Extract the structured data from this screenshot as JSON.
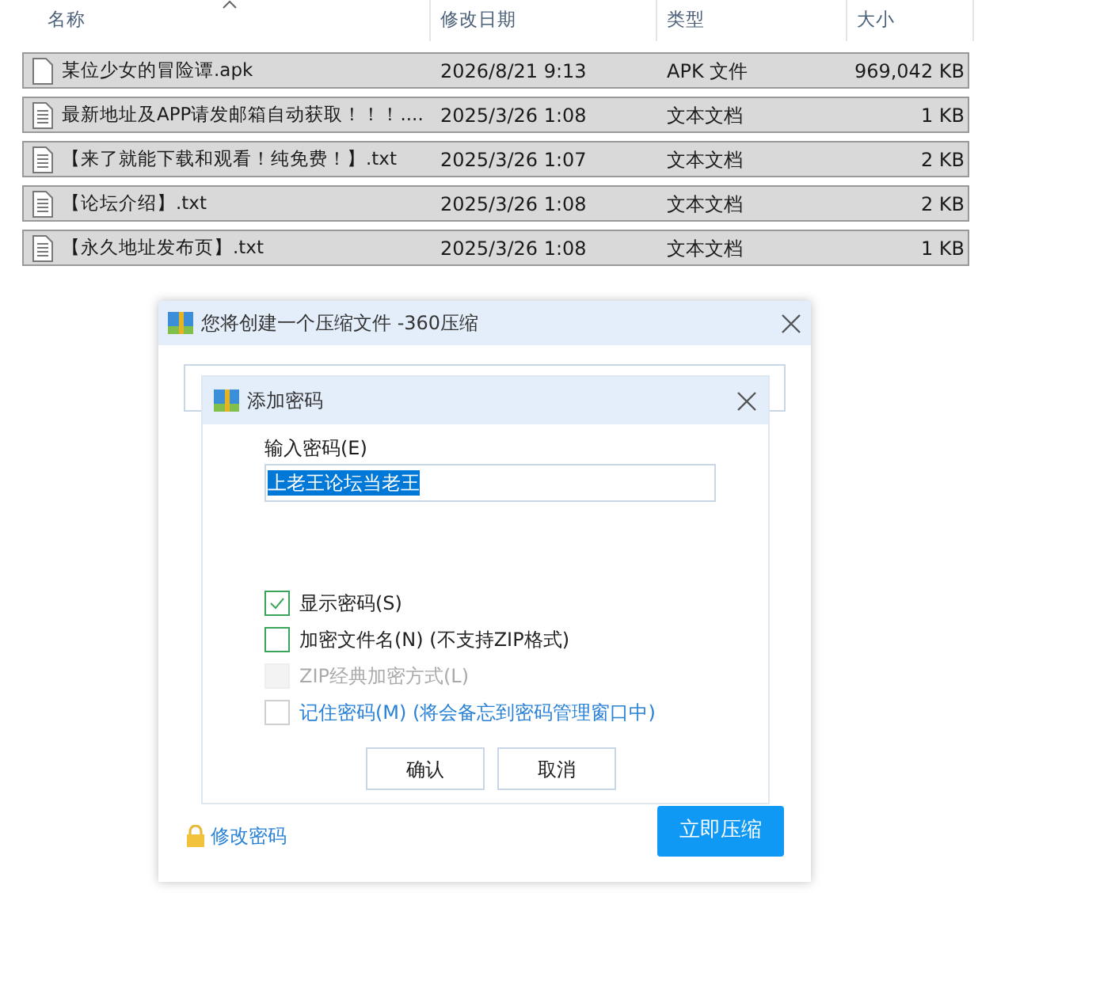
{
  "explorer": {
    "columns": [
      {
        "label": "名称",
        "sorted": true
      },
      {
        "label": "修改日期",
        "sorted": false
      },
      {
        "label": "类型",
        "sorted": false
      },
      {
        "label": "大小",
        "sorted": false
      }
    ],
    "rows": [
      {
        "name": "某位少女的冒险谭.apk",
        "date": "2026/8/21 9:13",
        "type": "APK 文件",
        "size": "969,042 KB",
        "kind": "blank",
        "selected": true
      },
      {
        "name": "最新地址及APP请发邮箱自动获取！！！....",
        "date": "2025/3/26 1:08",
        "type": "文本文档",
        "size": "1 KB",
        "kind": "text",
        "selected": true
      },
      {
        "name": "【来了就能下载和观看！纯免费！】.txt",
        "date": "2025/3/26 1:07",
        "type": "文本文档",
        "size": "2 KB",
        "kind": "text",
        "selected": true
      },
      {
        "name": "【论坛介绍】.txt",
        "date": "2025/3/26 1:08",
        "type": "文本文档",
        "size": "2 KB",
        "kind": "text",
        "selected": true
      },
      {
        "name": "【永久地址发布页】.txt",
        "date": "2025/3/26 1:08",
        "type": "文本文档",
        "size": "1 KB",
        "kind": "text",
        "selected": true
      }
    ]
  },
  "compress_dialog": {
    "title": "您将创建一个压缩文件 -360压缩",
    "change_password_link": "修改密码",
    "compress_button": "立即压缩"
  },
  "password_dialog": {
    "title": "添加密码",
    "password_label": "输入密码(E)",
    "password_value": "上老王论坛当老王",
    "options": [
      {
        "label": "显示密码(S)",
        "checked": true,
        "disabled": false,
        "kind": "plain"
      },
      {
        "label": "加密文件名(N) (不支持ZIP格式)",
        "checked": false,
        "disabled": false,
        "kind": "plain"
      },
      {
        "label": "ZIP经典加密方式(L)",
        "checked": false,
        "disabled": true,
        "kind": "plain"
      },
      {
        "label": "记住密码(M) (将会备忘到密码管理窗口中)",
        "checked": false,
        "disabled": false,
        "kind": "note"
      }
    ],
    "buttons": [
      "确认",
      "取消"
    ]
  }
}
